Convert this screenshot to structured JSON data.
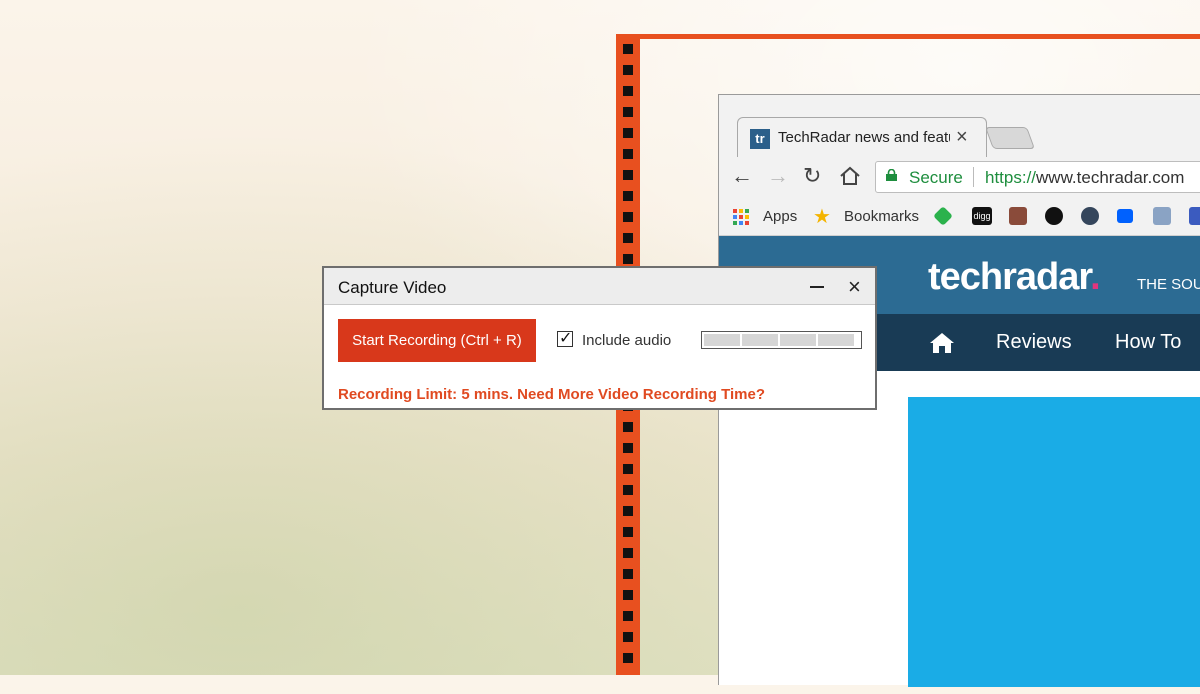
{
  "dialog": {
    "title": "Capture Video",
    "record_button": "Start Recording (Ctrl + R)",
    "include_audio_label": "Include audio",
    "include_audio_checked": true,
    "limit_message": "Recording Limit: 5 mins. Need More Video Recording Time?"
  },
  "browser": {
    "tab": {
      "favicon_text": "tr",
      "title": "TechRadar news and features"
    },
    "address": {
      "secure_label": "Secure",
      "url_scheme": "https://",
      "url_host": "www.techradar.com"
    },
    "bookmarks": [
      {
        "label": "Apps",
        "icon": "apps-grid-icon"
      },
      {
        "label": "Bookmarks",
        "icon": "star-icon"
      }
    ],
    "bookmark_icons": [
      "feedly-icon",
      "digg-icon",
      "photo-icon",
      "github-icon",
      "tumblr-icon",
      "dropbox-icon",
      "bookmark-image-icon",
      "extension-icon"
    ],
    "bookmark_digg_text": "digg"
  },
  "site": {
    "logo": "techradar",
    "logo_dot": ".",
    "tagline": "THE SOU",
    "nav": [
      "Reviews",
      "How To"
    ]
  },
  "colors": {
    "accent": "#e8501f",
    "record_button": "#d8381b",
    "site_header": "#2c6b93",
    "site_nav": "#193b55",
    "hero": "#1aace6"
  }
}
